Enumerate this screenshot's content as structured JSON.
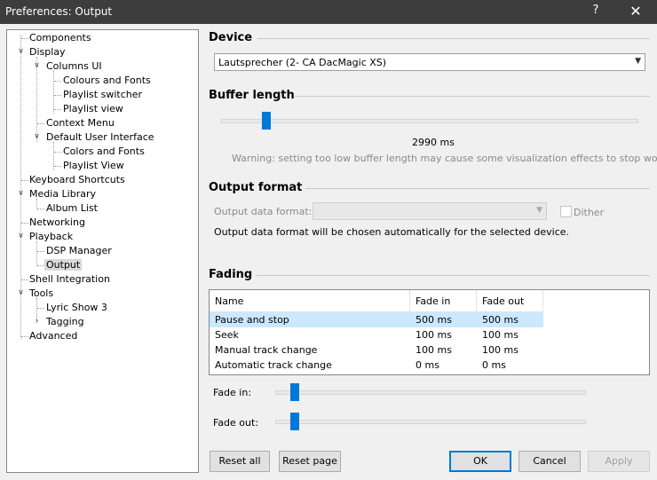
{
  "window": {
    "title": "Preferences: Output",
    "help": "?",
    "close": "✕"
  },
  "tree": {
    "items": [
      {
        "label": "Components"
      },
      {
        "label": "Display"
      },
      {
        "label": "Columns UI"
      },
      {
        "label": "Colours and Fonts"
      },
      {
        "label": "Playlist switcher"
      },
      {
        "label": "Playlist view"
      },
      {
        "label": "Context Menu"
      },
      {
        "label": "Default User Interface"
      },
      {
        "label": "Colors and Fonts"
      },
      {
        "label": "Playlist View"
      },
      {
        "label": "Keyboard Shortcuts"
      },
      {
        "label": "Media Library"
      },
      {
        "label": "Album List"
      },
      {
        "label": "Networking"
      },
      {
        "label": "Playback"
      },
      {
        "label": "DSP Manager"
      },
      {
        "label": "Output"
      },
      {
        "label": "Shell Integration"
      },
      {
        "label": "Tools"
      },
      {
        "label": "Lyric Show 3"
      },
      {
        "label": "Tagging"
      },
      {
        "label": "Advanced"
      }
    ],
    "selected": "Output"
  },
  "device": {
    "title": "Device",
    "value": "Lautsprecher (2- CA DacMagic XS)"
  },
  "buffer": {
    "title": "Buffer length",
    "value_text": "2990 ms",
    "level": 0.1,
    "warning": "Warning: setting too low buffer length may cause some visualization effects to stop working."
  },
  "output_format": {
    "title": "Output format",
    "label": "Output data format:",
    "value": "",
    "dither_label": "Dither",
    "dither_checked": false,
    "note": "Output data format will be chosen automatically for the selected device."
  },
  "fading": {
    "title": "Fading",
    "columns": [
      "Name",
      "Fade in",
      "Fade out"
    ],
    "rows": [
      {
        "name": "Pause and stop",
        "fade_in": "500 ms",
        "fade_out": "500 ms",
        "selected": true
      },
      {
        "name": "Seek",
        "fade_in": "100 ms",
        "fade_out": "100 ms"
      },
      {
        "name": "Manual track change",
        "fade_in": "100 ms",
        "fade_out": "100 ms"
      },
      {
        "name": "Automatic track change",
        "fade_in": "0 ms",
        "fade_out": "0 ms"
      }
    ],
    "fade_in_label": "Fade in:",
    "fade_out_label": "Fade out:",
    "fade_in_level": 0.05,
    "fade_out_level": 0.05
  },
  "buttons": {
    "reset_all": "Reset all",
    "reset_page": "Reset page",
    "ok": "OK",
    "cancel": "Cancel",
    "apply": "Apply"
  },
  "colors": {
    "accent": "#0078d7",
    "titlebar": "#3d3d3d",
    "selection": "#cce8ff"
  }
}
